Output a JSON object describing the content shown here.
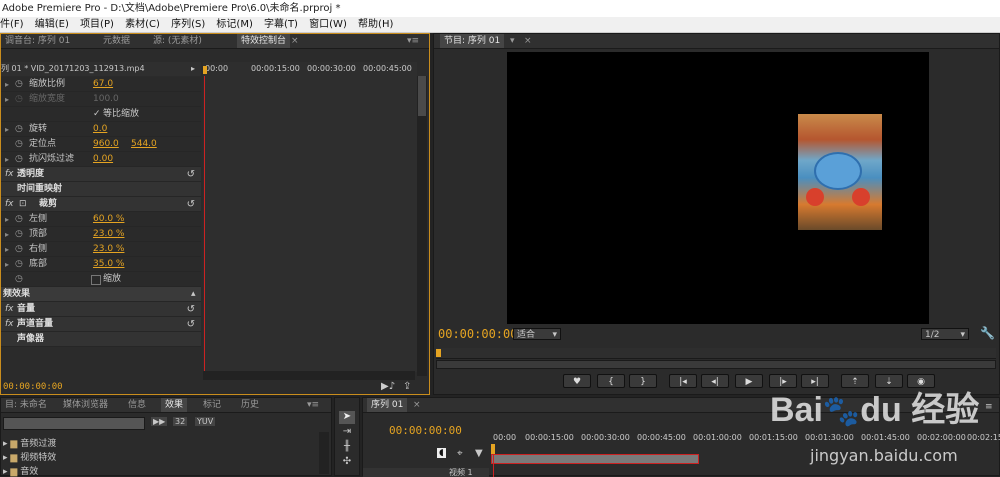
{
  "window": {
    "title": "Adobe Premiere Pro - D:\\文档\\Adobe\\Premiere Pro\\6.0\\未命名.prproj *"
  },
  "menu": [
    "件(F)",
    "编辑(E)",
    "项目(P)",
    "素材(C)",
    "序列(S)",
    "标记(M)",
    "字幕(T)",
    "窗口(W)",
    "帮助(H)"
  ],
  "effect_panel": {
    "tabs": [
      "调音台: 序列 01",
      "元数据",
      "源: (无素材)",
      "特效控制台"
    ],
    "clip_path": "列 01 * VID_20171203_112913.mp4",
    "timecodes": [
      "00:00",
      "00:00:15:00",
      "00:00:30:00",
      "00:00:45:00"
    ],
    "rows": {
      "scale": {
        "label": "缩放比例",
        "value": "67.0"
      },
      "scale_width": {
        "label": "缩放宽度",
        "value": "100.0"
      },
      "uniform": {
        "label": "等比缩放"
      },
      "rotation": {
        "label": "旋转",
        "value": "0.0"
      },
      "position": {
        "label": "定位点",
        "x": "960.0",
        "y": "544.0"
      },
      "antiflicker": {
        "label": "抗闪烁过滤",
        "value": "0.00"
      },
      "opacity": {
        "label": "透明度"
      },
      "time_remap": {
        "label": "时间重映射"
      },
      "crop": {
        "label": "裁剪"
      },
      "left": {
        "label": "左侧",
        "value": "60.0 %"
      },
      "top": {
        "label": "顶部",
        "value": "23.0 %"
      },
      "right": {
        "label": "右侧",
        "value": "23.0 %"
      },
      "bottom": {
        "label": "底部",
        "value": "35.0 %"
      },
      "zoom": {
        "label": "缩放"
      },
      "audio_effects": {
        "label": "频效果"
      },
      "volume": {
        "label": "音量"
      },
      "channel_volume": {
        "label": "声道音量"
      },
      "panner": {
        "label": "声像器"
      }
    },
    "timecode": "00:00:00:00"
  },
  "program_monitor": {
    "tab": "节目: 序列 01",
    "timecode": "00:00:00:00",
    "fit": "适合",
    "ratio": "1/2"
  },
  "project_panel": {
    "tabs": [
      "目: 未命名",
      "媒体浏览器",
      "信息",
      "效果",
      "标记",
      "历史"
    ],
    "folders": [
      "音频过渡",
      "视频特效",
      "音效"
    ]
  },
  "sequence": {
    "tab": "序列 01",
    "timecode": "00:00:00:00",
    "ruler": [
      "00:00",
      "00:00:15:00",
      "00:00:30:00",
      "00:00:45:00",
      "00:01:00:00",
      "00:01:15:00",
      "00:01:30:00",
      "00:01:45:00",
      "00:02:00:00",
      "00:02:15:00"
    ],
    "track_label": "视频 1"
  },
  "watermark": "jingyan.baidu.com"
}
